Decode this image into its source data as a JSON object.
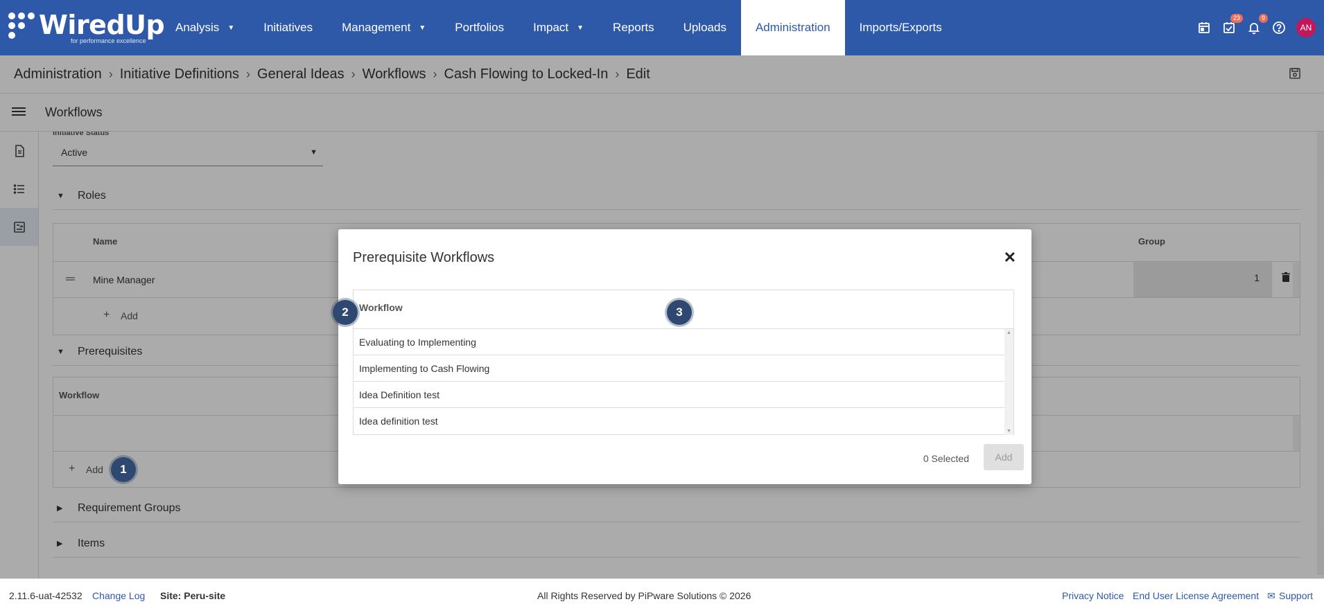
{
  "brand": {
    "name": "WiredUp",
    "tagline": "for performance excellence"
  },
  "nav": {
    "items": [
      {
        "label": "Analysis",
        "has_caret": true
      },
      {
        "label": "Initiatives",
        "has_caret": false
      },
      {
        "label": "Management",
        "has_caret": true
      },
      {
        "label": "Portfolios",
        "has_caret": false
      },
      {
        "label": "Impact",
        "has_caret": true
      },
      {
        "label": "Reports",
        "has_caret": false
      },
      {
        "label": "Uploads",
        "has_caret": false
      },
      {
        "label": "Administration",
        "has_caret": false,
        "active": true
      },
      {
        "label": "Imports/Exports",
        "has_caret": false
      }
    ],
    "tasks_badge": "23",
    "notifications_badge": "9",
    "avatar_initials": "AN"
  },
  "breadcrumb": [
    "Administration",
    "Initiative Definitions",
    "General Ideas",
    "Workflows",
    "Cash Flowing to Locked-In",
    "Edit"
  ],
  "subheader": {
    "title": "Workflows"
  },
  "form": {
    "status_label": "Initiative Status",
    "status_value": "Active"
  },
  "roles": {
    "title": "Roles",
    "col_name": "Name",
    "col_group": "Group",
    "rows": [
      {
        "name": "Mine Manager",
        "group": "1"
      }
    ],
    "add_label": "Add"
  },
  "prerequisites": {
    "title": "Prerequisites",
    "col_workflow": "Workflow",
    "add_label": "Add"
  },
  "requirement_groups": {
    "title": "Requirement Groups"
  },
  "items": {
    "title": "Items"
  },
  "modal": {
    "title": "Prerequisite Workflows",
    "col_workflow": "Workflow",
    "rows": [
      "Evaluating to Implementing",
      "Implementing to Cash Flowing",
      "Idea Definition test",
      "Idea definition test"
    ],
    "selected_count": "0 Selected",
    "add_label": "Add"
  },
  "markers": [
    "1",
    "2",
    "3"
  ],
  "footer": {
    "version": "2.11.6-uat-42532",
    "changelog": "Change Log",
    "site": "Site: Peru-site",
    "copyright": "All Rights Reserved by PiPware Solutions © 2026",
    "privacy": "Privacy Notice",
    "eula": "End User License Agreement",
    "support": "Support"
  },
  "colors": {
    "nav_bg": "#2d59a8",
    "marker": "#2e4870",
    "avatar": "#c2185b"
  }
}
